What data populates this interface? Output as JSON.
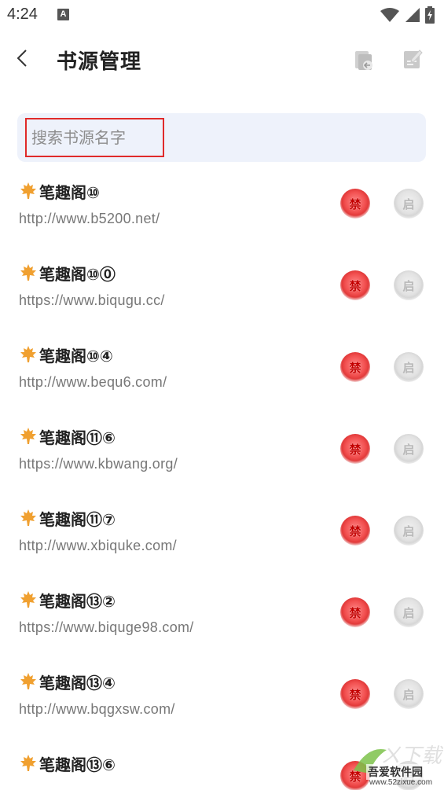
{
  "status_bar": {
    "time": "4:24",
    "notification_badge": "A",
    "icons": [
      "wifi-icon",
      "signal-icon",
      "battery-icon"
    ]
  },
  "app_bar": {
    "title": "书源管理",
    "back_icon": "back-arrow-icon",
    "actions": [
      "import-icon",
      "edit-icon"
    ]
  },
  "search": {
    "placeholder": "搜索书源名字",
    "value": ""
  },
  "sources": [
    {
      "name": "笔趣阁⑩",
      "url": "http://www.b5200.net/",
      "ban_label": "禁",
      "enable_label": "启"
    },
    {
      "name": "笔趣阁⑩⓪",
      "url": "https://www.biqugu.cc/",
      "ban_label": "禁",
      "enable_label": "启"
    },
    {
      "name": "笔趣阁⑩④",
      "url": "http://www.bequ6.com/",
      "ban_label": "禁",
      "enable_label": "启"
    },
    {
      "name": "笔趣阁⑪⑥",
      "url": "https://www.kbwang.org/",
      "ban_label": "禁",
      "enable_label": "启"
    },
    {
      "name": "笔趣阁⑪⑦",
      "url": "http://www.xbiquke.com/",
      "ban_label": "禁",
      "enable_label": "启"
    },
    {
      "name": "笔趣阁⑬②",
      "url": "https://www.biquge98.com/",
      "ban_label": "禁",
      "enable_label": "启"
    },
    {
      "name": "笔趣阁⑬④",
      "url": "http://www.bqgxsw.com/",
      "ban_label": "禁",
      "enable_label": "启"
    },
    {
      "name": "笔趣阁⑬⑥",
      "url": "",
      "ban_label": "禁",
      "enable_label": "启"
    }
  ],
  "colors": {
    "accent_red": "#e23a3a",
    "search_bg": "#eef2fb",
    "highlight_border": "#e02a2a",
    "leaf_orange": "#f0a030"
  },
  "watermark": {
    "line1": "吾爱软件园",
    "line2": "www.52zixue.com"
  }
}
